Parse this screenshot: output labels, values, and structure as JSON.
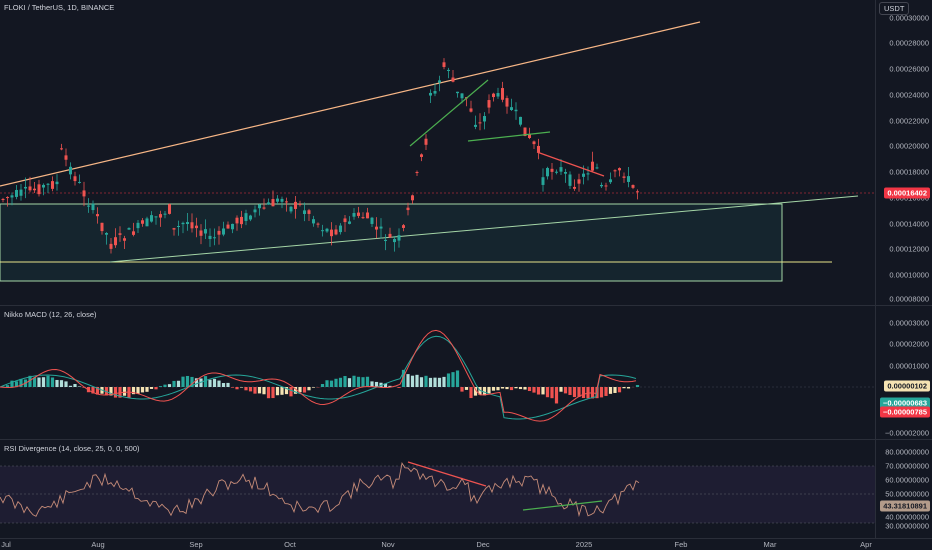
{
  "symbol_title": "FLOKI / TetherUS, 1D, BINANCE",
  "currency_button": "USDT",
  "colors": {
    "up": "#26a69a",
    "down": "#ef5350",
    "bg": "#131722",
    "trendline": "#f7b686",
    "channel": "#a5d6a7",
    "last_price": "#f23645"
  },
  "price_axis": {
    "ticks": [
      "0.00030000",
      "0.00028000",
      "0.00026000",
      "0.00024000",
      "0.00022000",
      "0.00020000",
      "0.00018000",
      "0.00016000",
      "0.00014000",
      "0.00012000",
      "0.00010000",
      "0.00008000"
    ],
    "last_price": "0.00016402"
  },
  "macd": {
    "title": "Nikko MACD (12, 26, close)",
    "ticks": [
      "0.00003000",
      "0.00002000",
      "0.00001000",
      "−0.00002000"
    ],
    "badge_hist": "0.00000102",
    "badge_signal": "−0.00000683",
    "badge_macd": "−0.00000785"
  },
  "rsi": {
    "title": "RSI Divergence (14, close, 25, 0, 0, 500)",
    "ticks": [
      "80.00000000",
      "70.00000000",
      "60.00000000",
      "50.00000000",
      "40.00000000",
      "30.00000000"
    ],
    "badge_value": "43.31810891"
  },
  "time_axis": [
    "Jul",
    "Aug",
    "Sep",
    "Oct",
    "Nov",
    "Dec",
    "2025",
    "Feb",
    "Mar",
    "Apr"
  ]
}
